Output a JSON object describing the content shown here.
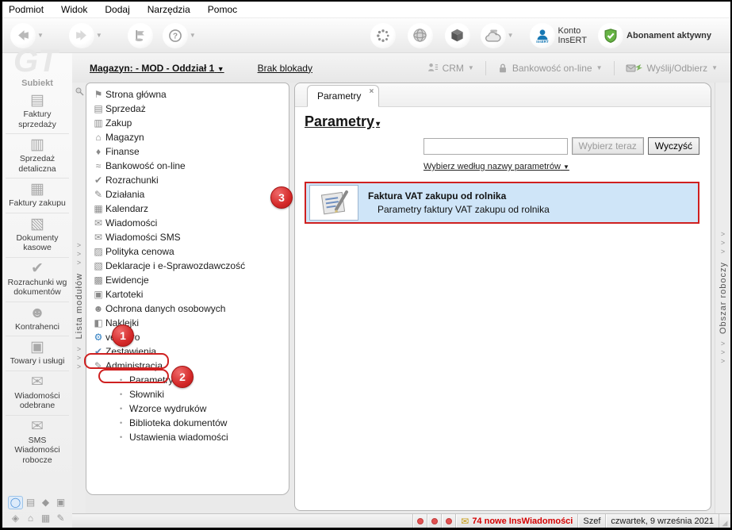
{
  "menu": {
    "items": [
      {
        "label": "Podmiot"
      },
      {
        "label": "Widok"
      },
      {
        "label": "Dodaj"
      },
      {
        "label": "Narzędzia"
      },
      {
        "label": "Pomoc"
      }
    ]
  },
  "toolbar": {
    "icons": [
      "nav-back-icon",
      "nav-forward-icon",
      "flag-icon",
      "help-icon",
      "dots-circle-icon",
      "globe-icon",
      "cube-icon",
      "cloud-database-icon",
      "insert-account-icon",
      "subscription-shield-icon"
    ],
    "dropdown_caret": "▼",
    "konto_line1": "Konto",
    "konto_line2": "InsERT",
    "abonament_label": "Abonament aktywny"
  },
  "infobar": {
    "magazyn_label": "Magazyn: - MOD - Oddział 1",
    "caret": "▼",
    "blokada_label": "Brak blokady",
    "crm_label": "CRM",
    "bank_label": "Bankowość on-line",
    "send_label": "Wyślij/Odbierz"
  },
  "sidebar": {
    "brand_watermark": "GT",
    "brand_name": "Subiekt",
    "modules": [
      {
        "glyph": "▤",
        "icon": "sales-invoices-icon",
        "label": "Faktury sprzedaży"
      },
      {
        "glyph": "▥",
        "icon": "retail-sales-icon",
        "label": "Sprzedaż detaliczna"
      },
      {
        "glyph": "▦",
        "icon": "purchase-invoices-icon",
        "label": "Faktury zakupu"
      },
      {
        "glyph": "▧",
        "icon": "cash-documents-icon",
        "label": "Dokumenty kasowe"
      },
      {
        "glyph": "✔",
        "icon": "settlements-by-documents-icon",
        "label": "Rozrachunki wg dokumentów"
      },
      {
        "glyph": "☻",
        "icon": "contractors-icon",
        "label": "Kontrahenci"
      },
      {
        "glyph": "▣",
        "icon": "goods-services-icon",
        "label": "Towary i usługi"
      },
      {
        "glyph": "✉",
        "icon": "received-messages-icon",
        "label": "Wiadomości odebrane"
      },
      {
        "glyph": "✉",
        "icon": "sms-draft-messages-icon",
        "label": "SMS Wiadomości robocze"
      }
    ],
    "shortcuts_row1": [
      {
        "glyph": "◯",
        "icon": "shortcut-circle-icon",
        "cls": "selected"
      },
      {
        "glyph": "▤",
        "icon": "shortcut-sales-icon",
        "cls": ""
      },
      {
        "glyph": "◆",
        "icon": "shortcut-finance-icon",
        "cls": ""
      },
      {
        "glyph": "▣",
        "icon": "shortcut-goods-icon",
        "cls": ""
      }
    ],
    "shortcuts_row2": [
      {
        "glyph": "◈",
        "icon": "shortcut-camera-icon",
        "cls": ""
      },
      {
        "glyph": "⌂",
        "icon": "shortcut-warehouse-icon",
        "cls": ""
      },
      {
        "glyph": "▦",
        "icon": "shortcut-box-icon",
        "cls": ""
      },
      {
        "glyph": "✎",
        "icon": "shortcut-notes-icon",
        "cls": ""
      }
    ]
  },
  "strips": {
    "left_label": "Lista modułów",
    "right_label": "Obszar roboczy",
    "chevron": ">"
  },
  "tree": {
    "items": [
      {
        "glyph": "⚑",
        "icon": "home-flag-icon",
        "label": "Strona główna",
        "cls": ""
      },
      {
        "glyph": "▤",
        "icon": "sales-icon",
        "label": "Sprzedaż",
        "cls": ""
      },
      {
        "glyph": "▥",
        "icon": "purchase-icon",
        "label": "Zakup",
        "cls": ""
      },
      {
        "glyph": "⌂",
        "icon": "warehouse-icon",
        "label": "Magazyn",
        "cls": ""
      },
      {
        "glyph": "♦",
        "icon": "finance-icon",
        "label": "Finanse",
        "cls": ""
      },
      {
        "glyph": "≈",
        "icon": "online-banking-icon",
        "label": "Bankowość on-line",
        "cls": ""
      },
      {
        "glyph": "✔",
        "icon": "settlements-icon",
        "label": "Rozrachunki",
        "cls": ""
      },
      {
        "glyph": "✎",
        "icon": "activities-icon",
        "label": "Działania",
        "cls": ""
      },
      {
        "glyph": "▦",
        "icon": "calendar-icon",
        "label": "Kalendarz",
        "cls": ""
      },
      {
        "glyph": "✉",
        "icon": "messages-icon",
        "label": "Wiadomości",
        "cls": ""
      },
      {
        "glyph": "✉",
        "icon": "sms-messages-icon",
        "label": "Wiadomości SMS",
        "cls": ""
      },
      {
        "glyph": "▨",
        "icon": "price-policy-icon",
        "label": "Polityka cenowa",
        "cls": ""
      },
      {
        "glyph": "▧",
        "icon": "declarations-icon",
        "label": "Deklaracje i e-Sprawozdawczość",
        "cls": ""
      },
      {
        "glyph": "▩",
        "icon": "records-icon",
        "label": "Ewidencje",
        "cls": ""
      },
      {
        "glyph": "▣",
        "icon": "card-files-icon",
        "label": "Kartoteki",
        "cls": ""
      },
      {
        "glyph": "☻",
        "icon": "personal-data-protection-icon",
        "label": "Ochrona danych osobowych",
        "cls": ""
      },
      {
        "glyph": "◧",
        "icon": "labels-icon",
        "label": "Naklejki",
        "cls": ""
      },
      {
        "glyph": "⚙",
        "icon": "vendero-icon",
        "label": "vendero",
        "cls": "blue"
      },
      {
        "glyph": "✔",
        "icon": "reports-icon",
        "label": "Zestawienia",
        "cls": "steel"
      },
      {
        "glyph": "✎",
        "icon": "administration-icon",
        "label": "Administracja",
        "cls": ""
      }
    ],
    "bullet": "•",
    "subitems": [
      {
        "label": "Parametry"
      },
      {
        "label": "Słowniki"
      },
      {
        "label": "Wzorce wydruków"
      },
      {
        "label": "Biblioteka dokumentów"
      },
      {
        "label": "Ustawienia wiadomości"
      }
    ]
  },
  "tabs": {
    "active_label": "Parametry",
    "close_glyph": "×"
  },
  "main": {
    "heading": "Parametry",
    "heading_caret": "▾",
    "search_value": "",
    "select_button": "Wybierz teraz",
    "clear_button": "Wyczyść",
    "filter_link": "Wybierz według nazwy parametrów",
    "filter_caret": "▼",
    "result": {
      "icon": "parameter-document-icon",
      "title": "Faktura VAT zakupu od rolnika",
      "desc": "Parametry faktury VAT zakupu od rolnika"
    }
  },
  "statusbar": {
    "envelope_glyph": "✉",
    "messages_label": "74 nowe InsWiadomości",
    "user_label": "Szef",
    "date_label": "czwartek, 9 września 2021"
  },
  "annotations": {
    "step1": "1",
    "step2": "2",
    "step3": "3"
  },
  "colors": {
    "annotation_red": "#cf2020",
    "selection_blue": "#cfe5f8",
    "insert_blue": "#1879b5",
    "shield_green": "#67b345",
    "alert_red": "#d40000"
  }
}
